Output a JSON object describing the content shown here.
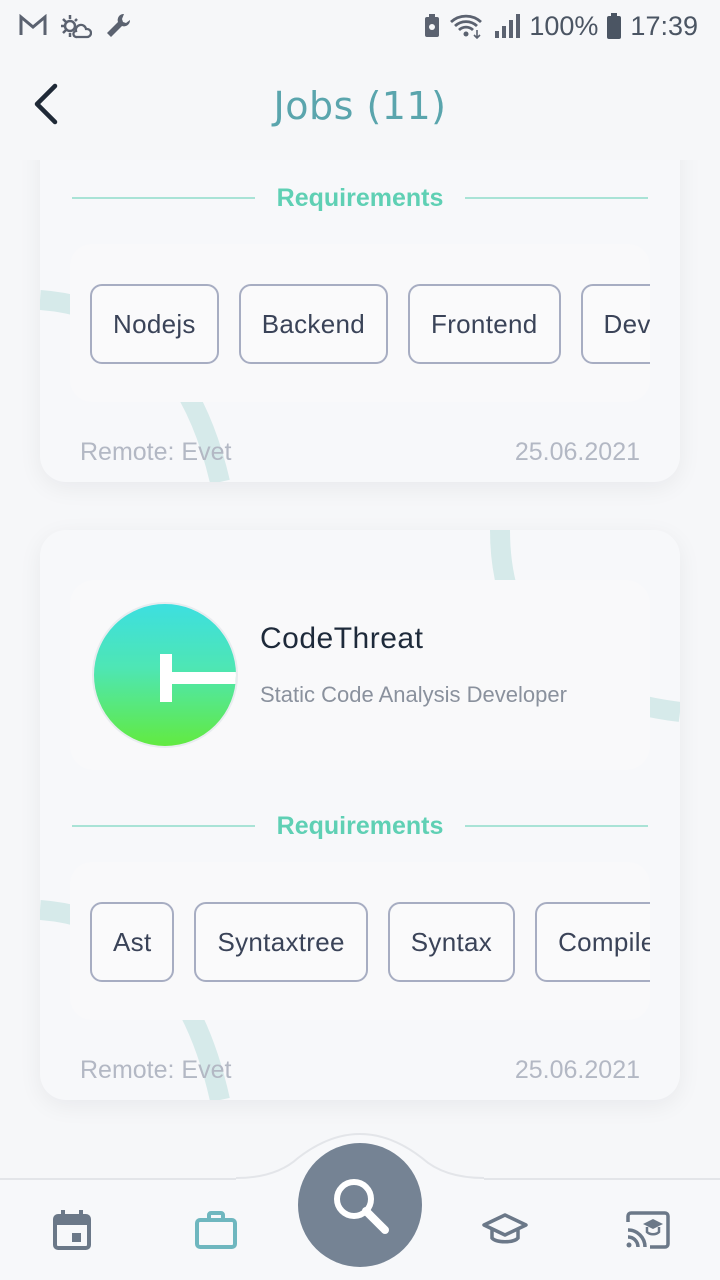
{
  "status_bar": {
    "battery": "100%",
    "time": "17:39"
  },
  "header": {
    "title": "Jobs (11)"
  },
  "jobs": [
    {
      "requirements_heading": "Requirements",
      "tags": [
        "Nodejs",
        "Backend",
        "Frontend",
        "Devops"
      ],
      "remote": "Remote: Evet",
      "date": "25.06.2021"
    },
    {
      "company": "CodeThreat",
      "position": "Static Code Analysis Developer",
      "requirements_heading": "Requirements",
      "tags": [
        "Ast",
        "Syntaxtree",
        "Syntax",
        "Compiler"
      ],
      "remote": "Remote: Evet",
      "date": "25.06.2021"
    }
  ],
  "bottom_nav": {
    "items": [
      {
        "name": "calendar-icon",
        "active": false
      },
      {
        "name": "briefcase-icon",
        "active": true
      },
      {
        "name": "search-icon",
        "active": false
      },
      {
        "name": "graduation-cap-icon",
        "active": false
      },
      {
        "name": "cast-education-icon",
        "active": false
      }
    ]
  },
  "colors": {
    "accent": "#5fd0b4",
    "title": "#5aa5ad",
    "fab": "#758394",
    "nav_icon": "#6b7888",
    "nav_active": "#6fb7bf"
  }
}
